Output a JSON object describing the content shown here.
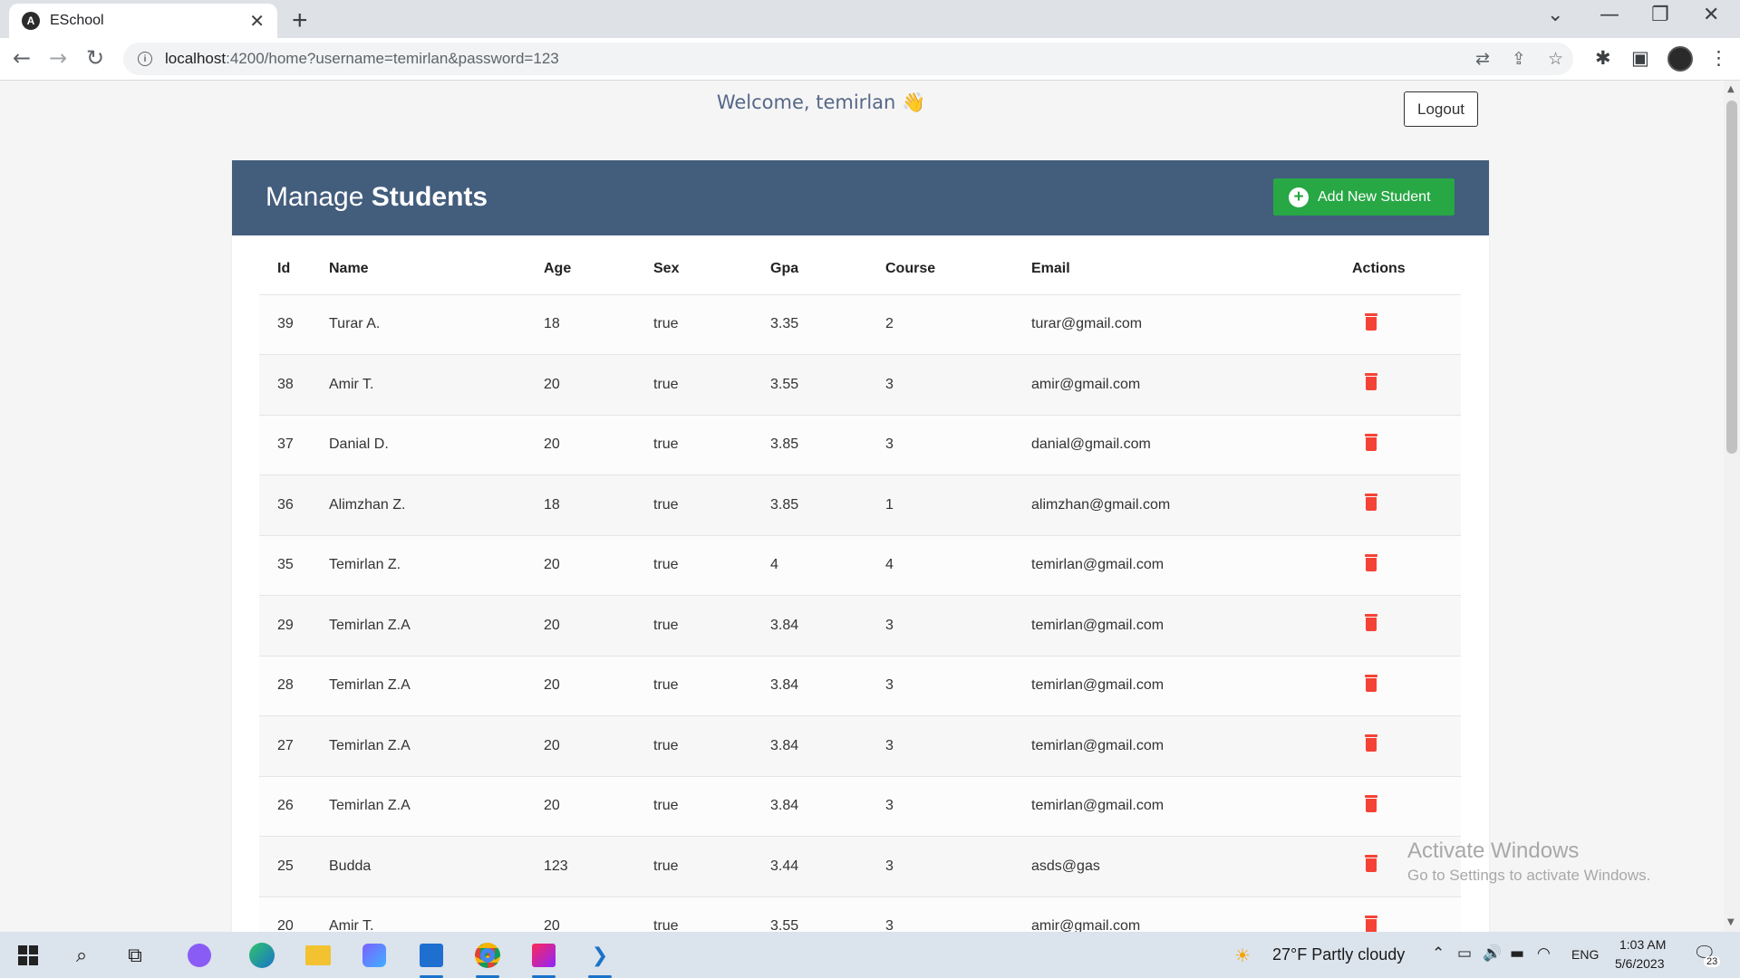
{
  "browser": {
    "tab_title": "ESchool",
    "tab_close": "✕",
    "new_tab": "+",
    "url_host": "localhost",
    "url_rest": ":4200/home?username=temirlan&password=123"
  },
  "page": {
    "welcome": "Welcome, temirlan 👋",
    "logout_label": "Logout",
    "title_light": "Manage ",
    "title_bold": "Students",
    "add_button_label": "Add New Student",
    "columns": [
      "Id",
      "Name",
      "Age",
      "Sex",
      "Gpa",
      "Course",
      "Email",
      "Actions"
    ],
    "rows": [
      {
        "id": "39",
        "name": "Turar A.",
        "age": "18",
        "sex": "true",
        "gpa": "3.35",
        "course": "2",
        "email": "turar@gmail.com"
      },
      {
        "id": "38",
        "name": "Amir T.",
        "age": "20",
        "sex": "true",
        "gpa": "3.55",
        "course": "3",
        "email": "amir@gmail.com"
      },
      {
        "id": "37",
        "name": "Danial D.",
        "age": "20",
        "sex": "true",
        "gpa": "3.85",
        "course": "3",
        "email": "danial@gmail.com"
      },
      {
        "id": "36",
        "name": "Alimzhan Z.",
        "age": "18",
        "sex": "true",
        "gpa": "3.85",
        "course": "1",
        "email": "alimzhan@gmail.com"
      },
      {
        "id": "35",
        "name": "Temirlan Z.",
        "age": "20",
        "sex": "true",
        "gpa": "4",
        "course": "4",
        "email": "temirlan@gmail.com"
      },
      {
        "id": "29",
        "name": "Temirlan Z.A",
        "age": "20",
        "sex": "true",
        "gpa": "3.84",
        "course": "3",
        "email": "temirlan@gmail.com"
      },
      {
        "id": "28",
        "name": "Temirlan Z.A",
        "age": "20",
        "sex": "true",
        "gpa": "3.84",
        "course": "3",
        "email": "temirlan@gmail.com"
      },
      {
        "id": "27",
        "name": "Temirlan Z.A",
        "age": "20",
        "sex": "true",
        "gpa": "3.84",
        "course": "3",
        "email": "temirlan@gmail.com"
      },
      {
        "id": "26",
        "name": "Temirlan Z.A",
        "age": "20",
        "sex": "true",
        "gpa": "3.84",
        "course": "3",
        "email": "temirlan@gmail.com"
      },
      {
        "id": "25",
        "name": "Budda",
        "age": "123",
        "sex": "true",
        "gpa": "3.44",
        "course": "3",
        "email": "asds@gas"
      },
      {
        "id": "20",
        "name": "Amir T.",
        "age": "20",
        "sex": "true",
        "gpa": "3.55",
        "course": "3",
        "email": "amir@gmail.com"
      }
    ]
  },
  "watermark": {
    "line1": "Activate Windows",
    "line2": "Go to Settings to activate Windows."
  },
  "taskbar": {
    "weather": "27°F  Partly cloudy",
    "language": "ENG",
    "time": "1:03 AM",
    "date": "5/6/2023",
    "notifications": "23"
  },
  "colors": {
    "header": "#435d7d",
    "add_button": "#28a745",
    "delete_icon": "#f44336"
  }
}
